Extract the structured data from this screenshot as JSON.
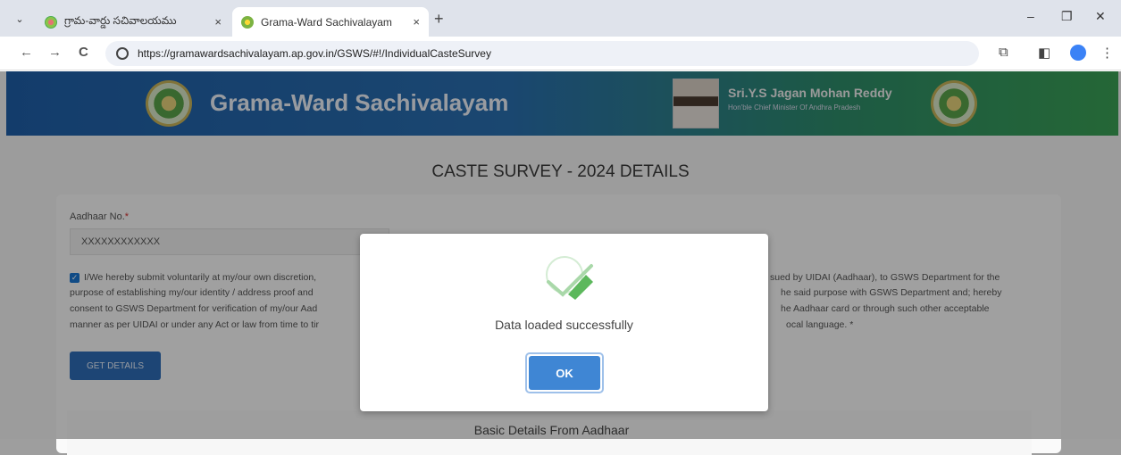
{
  "browser": {
    "tabs": [
      {
        "title": "గ్రామ-వార్డు సచివాలయము",
        "close": "×"
      },
      {
        "title": "Grama-Ward Sachivalayam",
        "close": "×"
      }
    ],
    "new_tab": "+",
    "window_controls": {
      "minimize": "–",
      "restore": "❐",
      "close": "✕"
    },
    "nav": {
      "back": "←",
      "forward": "→",
      "reload": "C"
    },
    "url": "https://gramawardsachivalayam.ap.gov.in/GSWS/#!/IndividualCasteSurvey",
    "toolbar_right": {
      "extensions": "⧉",
      "sidebar": "◧",
      "menu": "⋮"
    },
    "tab_menu": "⌄"
  },
  "banner": {
    "brand": "Grama-Ward Sachivalayam",
    "cm_name": "Sri.Y.S Jagan Mohan Reddy",
    "cm_title": "Hon'ble Chief Minister Of Andhra Pradesh"
  },
  "page": {
    "heading": "CASTE SURVEY - 2024 DETAILS",
    "aadhaar_label": "Aadhaar No.",
    "required_mark": "*",
    "aadhaar_value": "XXXXXXXXXXXX",
    "consent_text": "I/We hereby submit voluntarily at my/our own discretion, [obscured by dialog] sued by UIDAI (Aadhaar), to GSWS Department for the purpose of establishing my/our identity / address proof and [obscured] he said purpose with GSWS Department and; hereby consent to GSWS Department for verification of my/our Aad[obscured] he Aadhaar card or through such other acceptable manner as per UIDAI or under any Act or law from time to ti[obscured] ocal language. *",
    "consent_lines": [
      [
        "I/We hereby submit voluntarily at my/our own discretion,",
        "sued by UIDAI (Aadhaar), to GSWS Department for the"
      ],
      [
        "purpose of establishing my/our identity / address proof and",
        "he said purpose with GSWS Department and; hereby"
      ],
      [
        "consent to GSWS Department for verification of my/our Aad",
        "he Aadhaar card or through such other acceptable"
      ],
      [
        "manner as per UIDAI or under any Act or law from time to tir",
        "ocal language. *"
      ]
    ],
    "get_details": "GET DETAILS",
    "section_heading": "Basic Details From Aadhaar"
  },
  "modal": {
    "message": "Data loaded successfully",
    "ok": "OK",
    "icon": "success-check-icon"
  },
  "colors": {
    "primary": "#2e6db8",
    "ok_button": "#3f86d4",
    "banner_left": "#1f5fa8",
    "banner_right": "#3aa155",
    "success_green": "#5cb85c"
  }
}
